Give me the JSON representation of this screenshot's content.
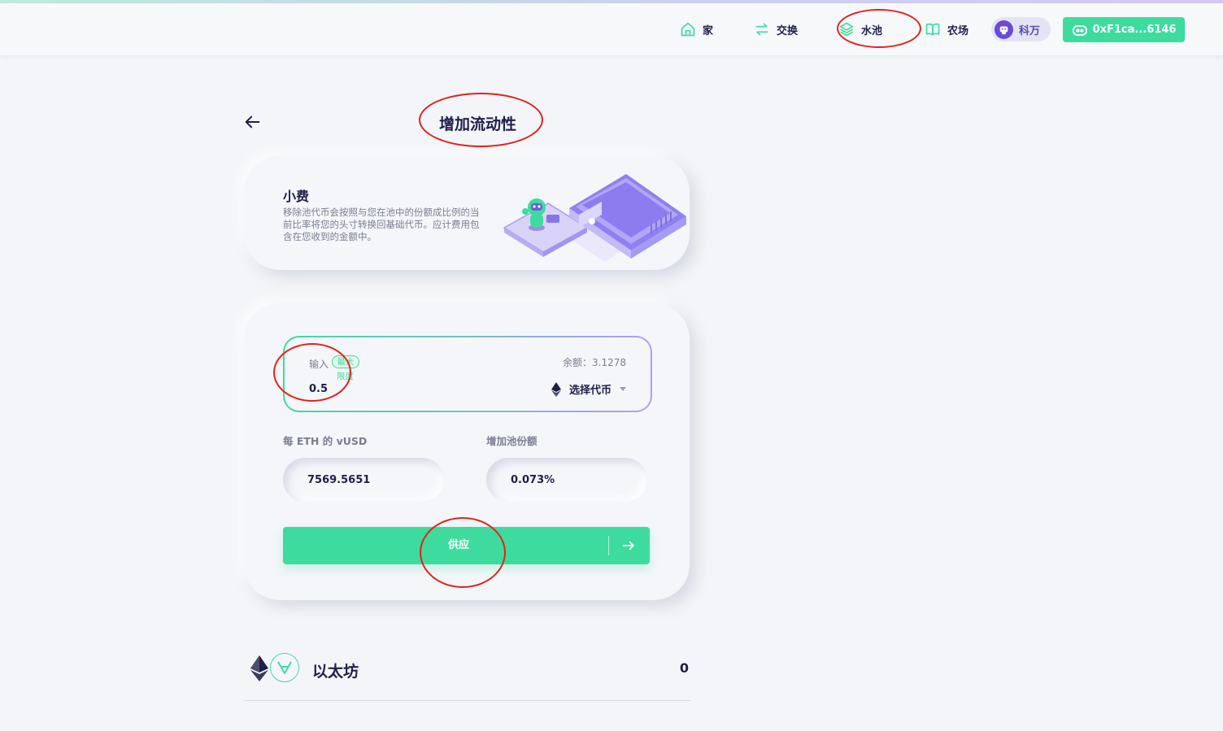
{
  "nav": {
    "home": "家",
    "swap": "交换",
    "pool": "水池",
    "farm": "农场",
    "profile": "科万",
    "wallet": "0xF1ca...6146"
  },
  "page": {
    "title": "增加流动性"
  },
  "info": {
    "title": "小费",
    "description": "移除池代币会按照与您在池中的份额成比例的当前比率将您的头寸转换回基础代币。应计费用包含在您收到的金额中。"
  },
  "input": {
    "label": "输入",
    "max_badge": "最大",
    "max_sub": "限度",
    "value": "0.5",
    "balance": "余额：3.1278",
    "token_select": "选择代币"
  },
  "rate": {
    "label": "每 ETH 的 vUSD",
    "value": "7569.5651"
  },
  "share": {
    "label": "增加池份额",
    "value": "0.073%"
  },
  "supply_button": "供应",
  "pair": {
    "name": "以太坊",
    "value": "0"
  },
  "colors": {
    "accent": "#3ddc9e",
    "text": "#1e1f4b",
    "muted": "#7a7d92",
    "background": "#f4f5f8",
    "annotation": "#e3221b",
    "profile": "#6a4ad8"
  },
  "icons": [
    "home-icon",
    "swap-icon",
    "layers-icon",
    "book-icon",
    "robot-avatar-icon",
    "wallet-robot-icon",
    "back-arrow-icon",
    "ethereum-icon",
    "dropdown-caret-icon",
    "arrow-right-icon",
    "vusd-icon"
  ]
}
